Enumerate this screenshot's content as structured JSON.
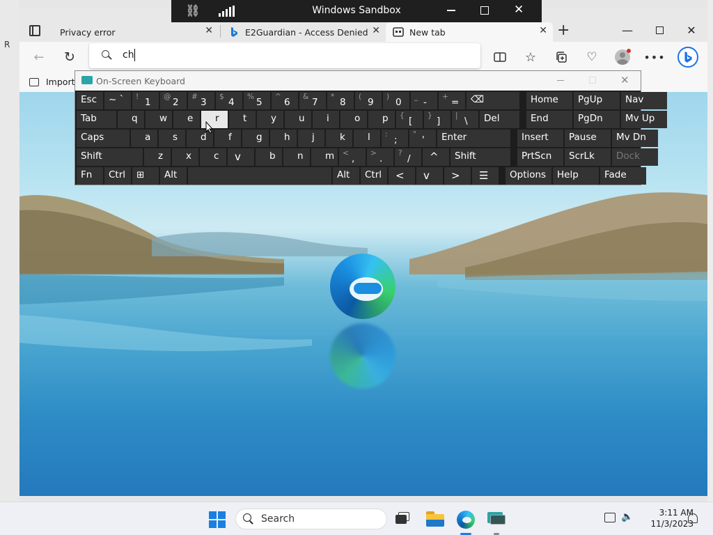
{
  "sandbox": {
    "title": "Windows Sandbox"
  },
  "desktop": {
    "left_fragment": "R"
  },
  "browser": {
    "tabs": [
      {
        "label": "Privacy error",
        "icon": "tab-actions-icon"
      },
      {
        "label": "E2Guardian - Access Denied",
        "icon": "bing-icon"
      },
      {
        "label": "New tab",
        "icon": "new-tab-icon",
        "active": true
      }
    ],
    "address": {
      "value": "ch"
    },
    "favorites": {
      "import_label": "Import f"
    }
  },
  "osk": {
    "title": "On-Screen Keyboard",
    "pressed_key": "r",
    "rows": [
      [
        [
          "Esc"
        ],
        [
          "~ `"
        ],
        [
          "1",
          "!"
        ],
        [
          "2",
          "@"
        ],
        [
          "3",
          "#"
        ],
        [
          "4",
          "$"
        ],
        [
          "5",
          "%"
        ],
        [
          "6",
          "^"
        ],
        [
          "7",
          "&"
        ],
        [
          "8",
          "*"
        ],
        [
          "9",
          "("
        ],
        [
          "0",
          ")"
        ],
        [
          "-",
          "_"
        ],
        [
          "=",
          "+"
        ],
        [
          "⌫"
        ],
        [
          "Home"
        ],
        [
          "PgUp"
        ],
        [
          "Nav"
        ]
      ],
      [
        [
          "Tab"
        ],
        [
          "q"
        ],
        [
          "w"
        ],
        [
          "e"
        ],
        [
          "r"
        ],
        [
          "t"
        ],
        [
          "y"
        ],
        [
          "u"
        ],
        [
          "i"
        ],
        [
          "o"
        ],
        [
          "p"
        ],
        [
          "[",
          "{"
        ],
        [
          "]",
          "}"
        ],
        [
          "\\",
          "|"
        ],
        [
          "Del"
        ],
        [
          "End"
        ],
        [
          "PgDn"
        ],
        [
          "Mv Up"
        ]
      ],
      [
        [
          "Caps"
        ],
        [
          "a"
        ],
        [
          "s"
        ],
        [
          "d"
        ],
        [
          "f"
        ],
        [
          "g"
        ],
        [
          "h"
        ],
        [
          "j"
        ],
        [
          "k"
        ],
        [
          "l"
        ],
        [
          ";",
          ":"
        ],
        [
          "'",
          "\""
        ],
        [
          "Enter"
        ],
        [
          "Insert"
        ],
        [
          "Pause"
        ],
        [
          "Mv Dn"
        ]
      ],
      [
        [
          "Shift"
        ],
        [
          "z"
        ],
        [
          "x"
        ],
        [
          "c"
        ],
        [
          "v"
        ],
        [
          "b"
        ],
        [
          "n"
        ],
        [
          "m"
        ],
        [
          ",",
          "<"
        ],
        [
          ".",
          ">"
        ],
        [
          "/",
          "?"
        ],
        [
          "^"
        ],
        [
          "Shift"
        ],
        [
          "PrtScn"
        ],
        [
          "ScrLk"
        ],
        [
          "Dock"
        ]
      ],
      [
        [
          "Fn"
        ],
        [
          "Ctrl"
        ],
        [
          "⊞"
        ],
        [
          "Alt"
        ],
        [
          ""
        ],
        [
          "Alt"
        ],
        [
          "Ctrl"
        ],
        [
          "<"
        ],
        [
          "v"
        ],
        [
          ">"
        ],
        [
          "☰"
        ],
        [
          "Options"
        ],
        [
          "Help"
        ],
        [
          "Fade"
        ]
      ]
    ]
  },
  "taskbar": {
    "search_label": "Search",
    "time": "3:11 AM",
    "date": "11/3/2023"
  },
  "colors": {
    "edge_blue": "#0c59a4",
    "edge_green": "#39d06e",
    "osk_key": "#333333",
    "taskbar": "#eef0f5"
  }
}
